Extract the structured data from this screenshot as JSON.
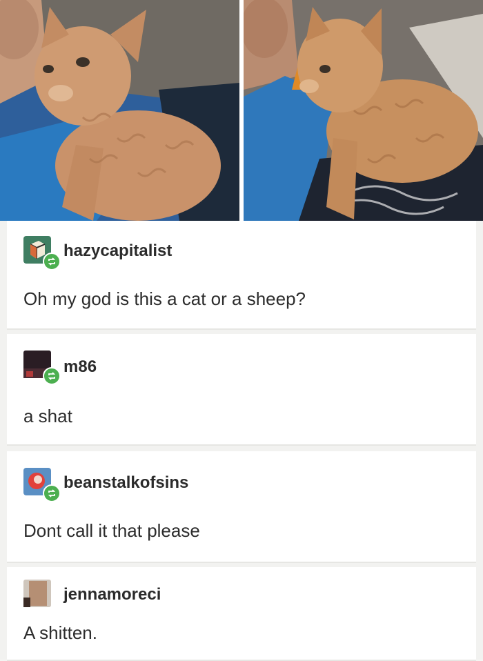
{
  "photos": [
    {
      "subject": "curly-coated kitten sitting on a blue blanket"
    },
    {
      "subject": "curly-coated kitten standing on a lap, side view"
    }
  ],
  "posts": [
    {
      "username": "hazycapitalist",
      "avatar_icon": "cube-avatar-icon",
      "message": "Oh my god is this a cat or a sheep?"
    },
    {
      "username": "m86",
      "avatar_icon": "dark-photo-avatar-icon",
      "message": "a shat"
    },
    {
      "username": "beanstalkofsins",
      "avatar_icon": "round-face-avatar-icon",
      "message": "Dont call it that please"
    },
    {
      "username": "jennamoreci",
      "avatar_icon": "portrait-avatar-icon",
      "message": "A shitten."
    }
  ],
  "colors": {
    "reblog_badge": "#4caf50",
    "background": "#f2f2f0"
  }
}
